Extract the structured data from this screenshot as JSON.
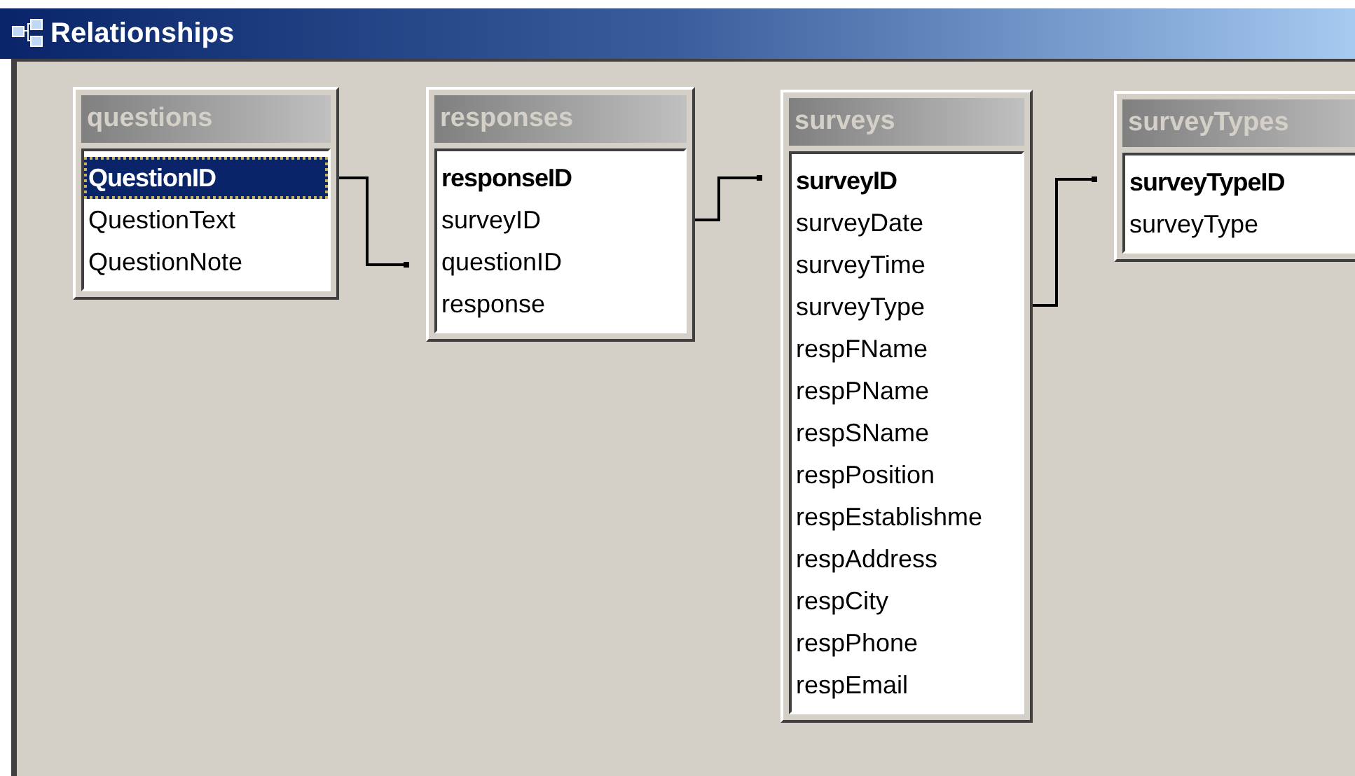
{
  "window": {
    "title": "Relationships"
  },
  "tables": [
    {
      "name": "questions",
      "fields": [
        {
          "name": "QuestionID",
          "key": true,
          "selected": true
        },
        {
          "name": "QuestionText",
          "key": false,
          "selected": false
        },
        {
          "name": "QuestionNote",
          "key": false,
          "selected": false
        }
      ]
    },
    {
      "name": "responses",
      "fields": [
        {
          "name": "responseID",
          "key": true,
          "selected": false
        },
        {
          "name": "surveyID",
          "key": false,
          "selected": false
        },
        {
          "name": "questionID",
          "key": false,
          "selected": false
        },
        {
          "name": "response",
          "key": false,
          "selected": false
        }
      ]
    },
    {
      "name": "surveys",
      "fields": [
        {
          "name": "surveyID",
          "key": true,
          "selected": false
        },
        {
          "name": "surveyDate",
          "key": false,
          "selected": false
        },
        {
          "name": "surveyTime",
          "key": false,
          "selected": false
        },
        {
          "name": "surveyType",
          "key": false,
          "selected": false
        },
        {
          "name": "respFName",
          "key": false,
          "selected": false
        },
        {
          "name": "respPName",
          "key": false,
          "selected": false
        },
        {
          "name": "respSName",
          "key": false,
          "selected": false
        },
        {
          "name": "respPosition",
          "key": false,
          "selected": false
        },
        {
          "name": "respEstablishme",
          "key": false,
          "selected": false
        },
        {
          "name": "respAddress",
          "key": false,
          "selected": false
        },
        {
          "name": "respCity",
          "key": false,
          "selected": false
        },
        {
          "name": "respPhone",
          "key": false,
          "selected": false
        },
        {
          "name": "respEmail",
          "key": false,
          "selected": false
        }
      ]
    },
    {
      "name": "surveyTypes",
      "fields": [
        {
          "name": "surveyTypeID",
          "key": true,
          "selected": false
        },
        {
          "name": "surveyType",
          "key": false,
          "selected": false
        }
      ]
    }
  ]
}
